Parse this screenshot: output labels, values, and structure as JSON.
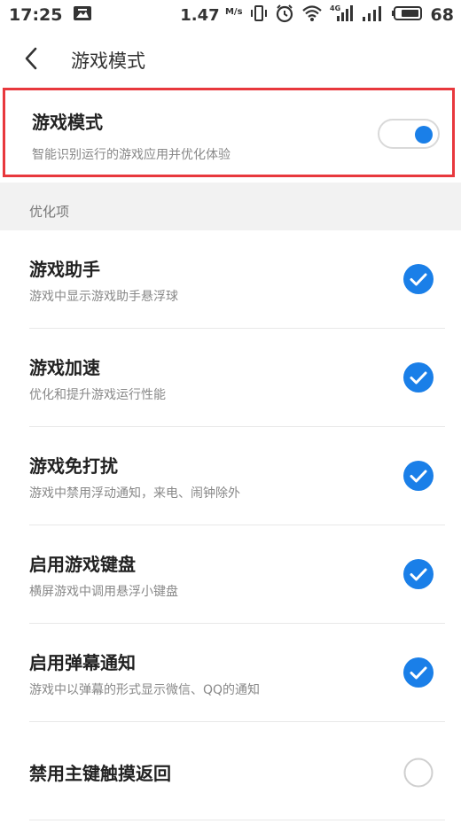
{
  "status_bar": {
    "time": "17:25",
    "speed": "1.47",
    "speed_unit": "M/s",
    "network_label": "4G",
    "battery": "68"
  },
  "header": {
    "title": "游戏模式"
  },
  "game_mode": {
    "title": "游戏模式",
    "subtitle": "智能识别运行的游戏应用并优化体验",
    "enabled": true
  },
  "section": {
    "label": "优化项"
  },
  "options": [
    {
      "title": "游戏助手",
      "subtitle": "游戏中显示游戏助手悬浮球",
      "checked": true
    },
    {
      "title": "游戏加速",
      "subtitle": "优化和提升游戏运行性能",
      "checked": true
    },
    {
      "title": "游戏免打扰",
      "subtitle": "游戏中禁用浮动通知，来电、闹钟除外",
      "checked": true
    },
    {
      "title": "启用游戏键盘",
      "subtitle": "横屏游戏中调用悬浮小键盘",
      "checked": true
    },
    {
      "title": "启用弹幕通知",
      "subtitle": "游戏中以弹幕的形式显示微信、QQ的通知",
      "checked": true
    },
    {
      "title": "禁用主键触摸返回",
      "checked": false
    }
  ],
  "colors": {
    "accent": "#1a7fe8",
    "highlight_border": "#e8383d",
    "section_bg": "#f2f2f2"
  }
}
